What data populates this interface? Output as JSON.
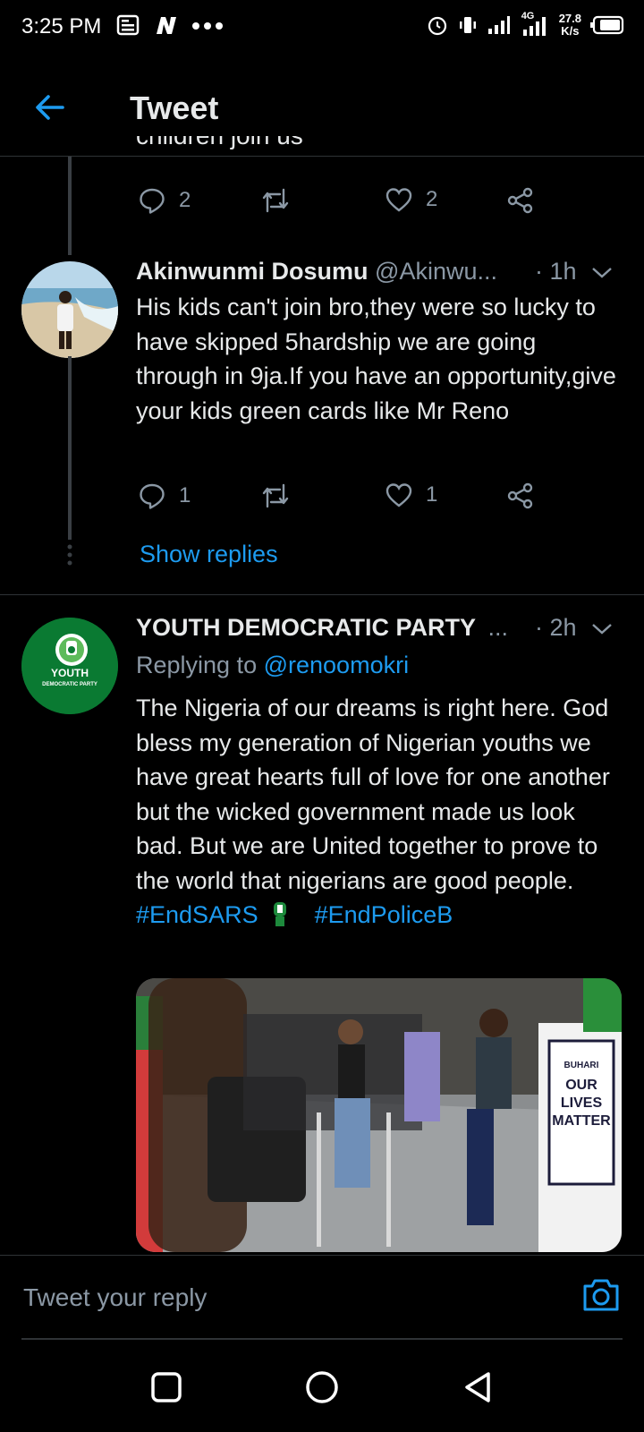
{
  "status_bar": {
    "time": "3:25 PM",
    "network": "4G",
    "speed_value": "27.8",
    "speed_unit": "K/s"
  },
  "header": {
    "title": "Tweet"
  },
  "tweet_top": {
    "cut_text": "children join us",
    "replies": "2",
    "likes": "2"
  },
  "tweet_reply": {
    "name": "Akinwunmi Dosumu",
    "handle": "@Akinwu...",
    "time": "· 1h",
    "text": "His kids can't join bro,they were so lucky to have skipped 5hardship we are going through in 9ja.If you have an opportunity,give your kids green cards like Mr Reno",
    "replies": "1",
    "likes": "1",
    "show_replies": "Show replies"
  },
  "tweet_ydp": {
    "name": "YOUTH DEMOCRATIC PARTY",
    "ellipsis": "...",
    "time": "· 2h",
    "replying_label": "Replying to",
    "replying_handle": "@renoomokri",
    "text": "The Nigeria of our dreams is right here. God bless my generation of Nigerian youths we have great hearts full of love for one another but the wicked government made us look bad. But we are United together to prove to the world that nigerians are good people.",
    "hashtag1": "#EndSARS",
    "hashtag2": "#EndPoliceB",
    "avatar_text_1": "YOUTH",
    "avatar_text_2": "DEMOCRATIC PARTY",
    "image_sign_1": "BUHARI",
    "image_sign_2": "OUR",
    "image_sign_3": "LIVES",
    "image_sign_4": "MATTER"
  },
  "reply_bar": {
    "placeholder": "Tweet your reply"
  },
  "colors": {
    "accent": "#1d9bf0",
    "muted": "#8b98a5",
    "background": "#000000"
  },
  "icons": [
    "alarm-icon",
    "vibrate-icon",
    "signal-icon",
    "battery-icon",
    "back-arrow-icon",
    "reply-icon",
    "retweet-icon",
    "like-icon",
    "share-icon",
    "chevron-down-icon",
    "camera-icon",
    "nav-square-icon",
    "nav-circle-icon",
    "nav-triangle-icon"
  ]
}
